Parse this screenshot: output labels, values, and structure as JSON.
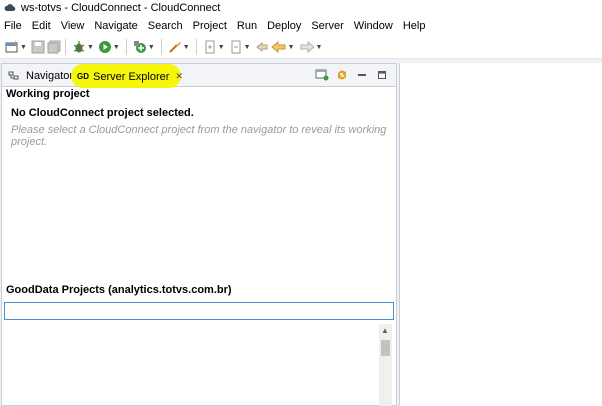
{
  "window": {
    "title": "ws-totvs - CloudConnect - CloudConnect",
    "icon": "cloud-icon"
  },
  "menubar": {
    "items": [
      "File",
      "Edit",
      "View",
      "Navigate",
      "Search",
      "Project",
      "Run",
      "Deploy",
      "Server",
      "Window",
      "Help"
    ]
  },
  "toolbar": {
    "icons": [
      "new-icon",
      "save-icon",
      "save-all-icon",
      "debug-icon",
      "run-icon",
      "new-wizard-icon",
      "open-resource-icon",
      "next-annotation-icon",
      "prev-annotation-icon",
      "last-edit-icon",
      "back-icon",
      "forward-icon"
    ]
  },
  "tabs": {
    "navigator": {
      "label": "Navigator"
    },
    "server_explorer": {
      "prefix": "GD",
      "label": "Server Explorer",
      "highlight_color": "#f5f500"
    }
  },
  "panel": {
    "working_project_title": "Working project",
    "no_project_message": "No CloudConnect project selected.",
    "no_project_hint": "Please select a CloudConnect project from the navigator to reveal its working project.",
    "gooddata_title": "GoodData Projects (analytics.totvs.com.br)",
    "filter_value": ""
  },
  "colors": {
    "accent_border": "#4a8fd6",
    "hint_text": "#9a9a9a"
  }
}
